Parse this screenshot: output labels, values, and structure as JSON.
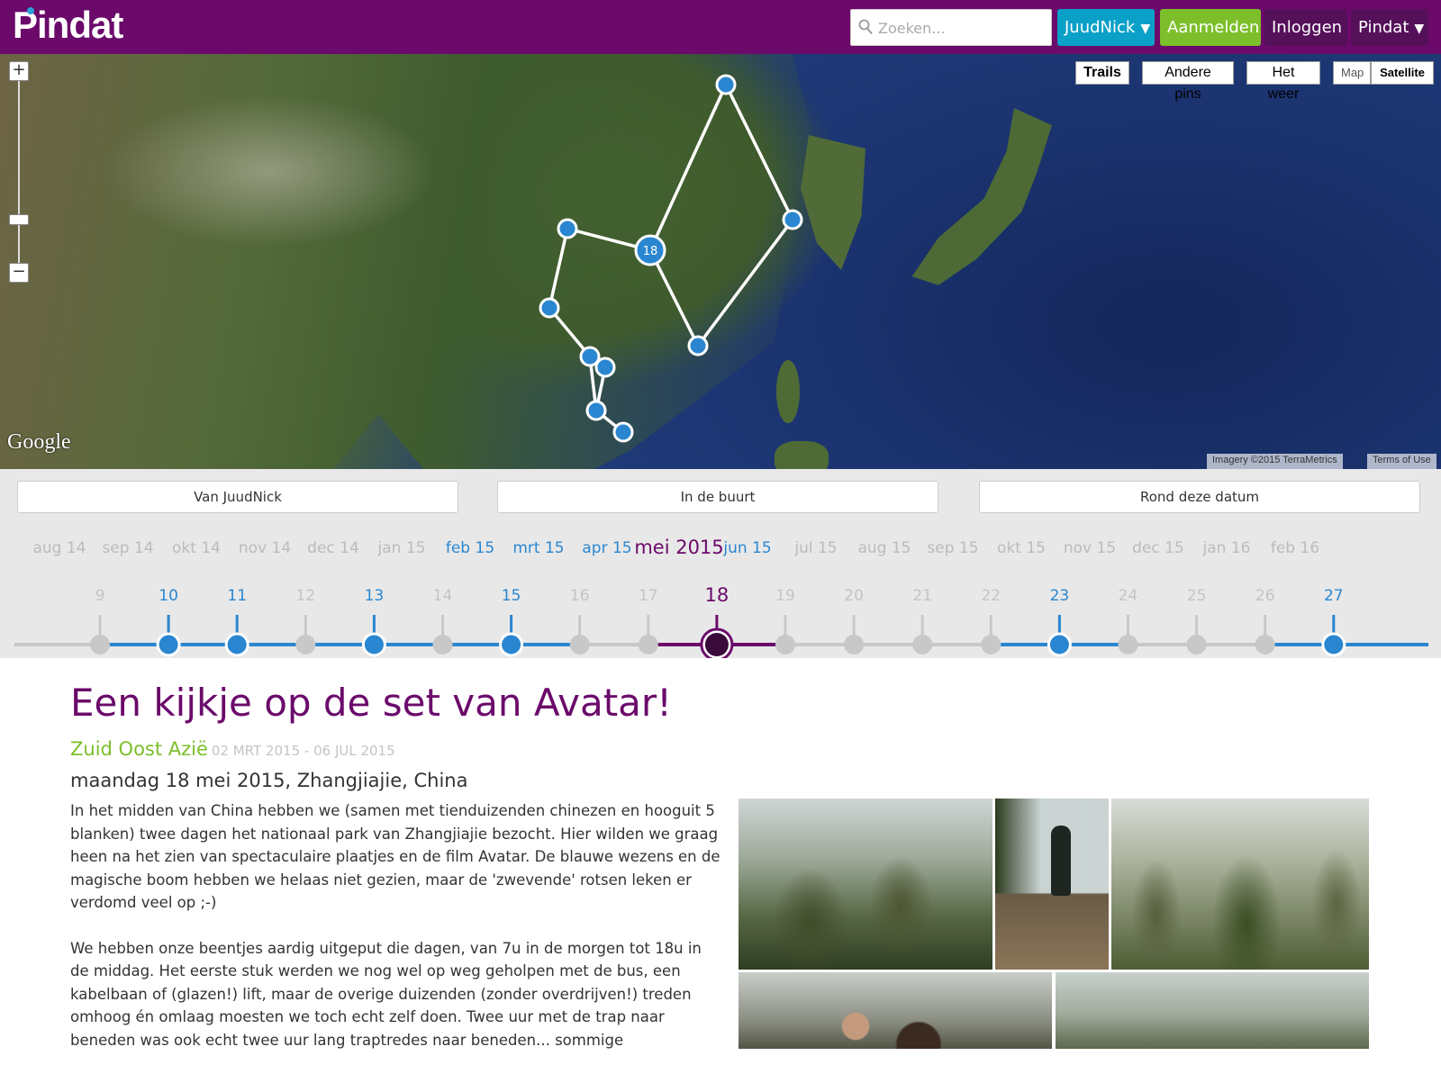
{
  "app": {
    "logo": "Pindat"
  },
  "topbar": {
    "search_placeholder": "Zoeken...",
    "user_label": "JuudNick",
    "signup_label": "Aanmelden",
    "login_label": "Inloggen",
    "menu_label": "Pindat",
    "caret": "▼",
    "colors": {
      "bar": "#6b0a6b",
      "user": "#0aa0c8",
      "signup": "#7cbf2a"
    }
  },
  "map": {
    "zoom_in": "+",
    "zoom_out": "−",
    "buttons": {
      "trails": "Trails",
      "andere_pins": "Andere pins",
      "het_weer": "Het weer",
      "map": "Map",
      "satellite": "Satellite"
    },
    "google_logo": "Google",
    "imagery": "Imagery ©2015 TerraMetrics",
    "terms": "Terms of Use",
    "highlighted_pin_label": "18"
  },
  "filters": {
    "van": "Van JuudNick",
    "buurt": "In de buurt",
    "datum": "Rond deze datum"
  },
  "timeline": {
    "months": [
      {
        "label": "aug 14",
        "state": "inactive"
      },
      {
        "label": "sep 14",
        "state": "inactive"
      },
      {
        "label": "okt 14",
        "state": "inactive"
      },
      {
        "label": "nov 14",
        "state": "inactive"
      },
      {
        "label": "dec 14",
        "state": "inactive"
      },
      {
        "label": "jan 15",
        "state": "inactive"
      },
      {
        "label": "feb 15",
        "state": "active"
      },
      {
        "label": "mrt 15",
        "state": "active"
      },
      {
        "label": "apr 15",
        "state": "active"
      },
      {
        "label": "mei 2015",
        "state": "current"
      },
      {
        "label": "jun 15",
        "state": "active"
      },
      {
        "label": "jul 15",
        "state": "inactive"
      },
      {
        "label": "aug 15",
        "state": "inactive"
      },
      {
        "label": "sep 15",
        "state": "inactive"
      },
      {
        "label": "okt 15",
        "state": "inactive"
      },
      {
        "label": "nov 15",
        "state": "inactive"
      },
      {
        "label": "dec 15",
        "state": "inactive"
      },
      {
        "label": "jan 16",
        "state": "inactive"
      },
      {
        "label": "feb 16",
        "state": "inactive"
      }
    ],
    "days": [
      {
        "label": "9",
        "state": "empty"
      },
      {
        "label": "10",
        "state": "post"
      },
      {
        "label": "11",
        "state": "post"
      },
      {
        "label": "12",
        "state": "empty"
      },
      {
        "label": "13",
        "state": "post"
      },
      {
        "label": "14",
        "state": "empty"
      },
      {
        "label": "15",
        "state": "post"
      },
      {
        "label": "16",
        "state": "empty"
      },
      {
        "label": "17",
        "state": "empty"
      },
      {
        "label": "18",
        "state": "current"
      },
      {
        "label": "19",
        "state": "empty"
      },
      {
        "label": "20",
        "state": "empty"
      },
      {
        "label": "21",
        "state": "empty"
      },
      {
        "label": "22",
        "state": "empty"
      },
      {
        "label": "23",
        "state": "post"
      },
      {
        "label": "24",
        "state": "empty"
      },
      {
        "label": "25",
        "state": "empty"
      },
      {
        "label": "26",
        "state": "empty"
      },
      {
        "label": "27",
        "state": "post"
      }
    ],
    "colors": {
      "post": "#2a86d0",
      "current": "#6b0a6b",
      "empty": "#c8c8c8"
    }
  },
  "article": {
    "title": "Een kijkje op de set van Avatar!",
    "trip_name": "Zuid Oost Azië",
    "trip_dates": "02 MRT 2015 - 06 JUL 2015",
    "dateline": "maandag 18 mei 2015, Zhangjiajie, China",
    "paragraphs": [
      "In het midden van China hebben we (samen met tienduizenden chinezen en hooguit 5 blanken) twee dagen het nationaal park van Zhangjiajie bezocht. Hier wilden we graag heen na het zien van spectaculaire plaatjes en de film Avatar. De blauwe wezens en de magische boom hebben we helaas niet gezien, maar de 'zwevende' rotsen leken er verdomd veel op ;-)",
      "We hebben onze beentjes aardig uitgeput die dagen, van 7u in de morgen tot 18u in de middag. Het eerste stuk werden we nog wel op weg geholpen met de bus, een kabelbaan of (glazen!) lift, maar de overige duizenden (zonder overdrijven!) treden omhoog én omlaag moesten we toch echt zelf doen. Twee uur met de trap naar beneden was ook echt twee uur lang traptredes naar beneden... sommige"
    ]
  }
}
